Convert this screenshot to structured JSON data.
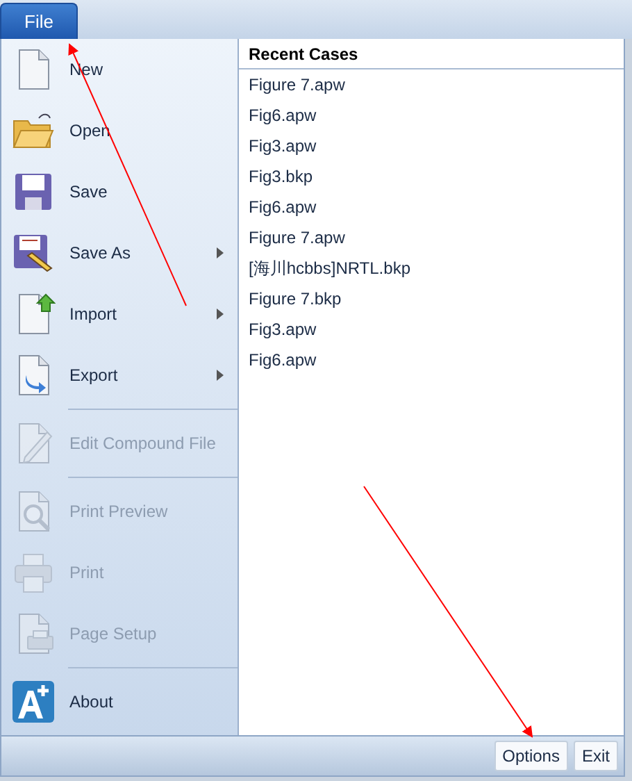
{
  "file_tab": {
    "label": "File",
    "selected": true
  },
  "menu_items": [
    {
      "kind": "command",
      "label": "New",
      "disabled": false,
      "submenu": false
    },
    {
      "kind": "command",
      "label": "Open",
      "disabled": false,
      "submenu": false
    },
    {
      "kind": "command",
      "label": "Save",
      "disabled": false,
      "submenu": false
    },
    {
      "kind": "command",
      "label": "Save As",
      "disabled": false,
      "submenu": true
    },
    {
      "kind": "command",
      "label": "Import",
      "disabled": false,
      "submenu": true
    },
    {
      "kind": "command",
      "label": "Export",
      "disabled": false,
      "submenu": true
    },
    {
      "kind": "separator"
    },
    {
      "kind": "command",
      "label": "Edit Compound File",
      "disabled": true,
      "submenu": false
    },
    {
      "kind": "separator"
    },
    {
      "kind": "command",
      "label": "Print Preview",
      "disabled": true,
      "submenu": false
    },
    {
      "kind": "command",
      "label": "Print",
      "disabled": true,
      "submenu": false
    },
    {
      "kind": "command",
      "label": "Page Setup",
      "disabled": true,
      "submenu": false
    },
    {
      "kind": "separator"
    },
    {
      "kind": "command",
      "label": "About",
      "disabled": false,
      "submenu": false
    }
  ],
  "recent": {
    "title": "Recent Cases",
    "files": [
      "Figure 7.apw",
      "Fig6.apw",
      "Fig3.apw",
      "Fig3.bkp",
      "Fig6.apw",
      "Figure 7.apw",
      "[海川hcbbs]NRTL.bkp",
      "Figure 7.bkp",
      "Fig3.apw",
      "Fig6.apw"
    ]
  },
  "buttons": [
    "Options",
    "Exit"
  ]
}
